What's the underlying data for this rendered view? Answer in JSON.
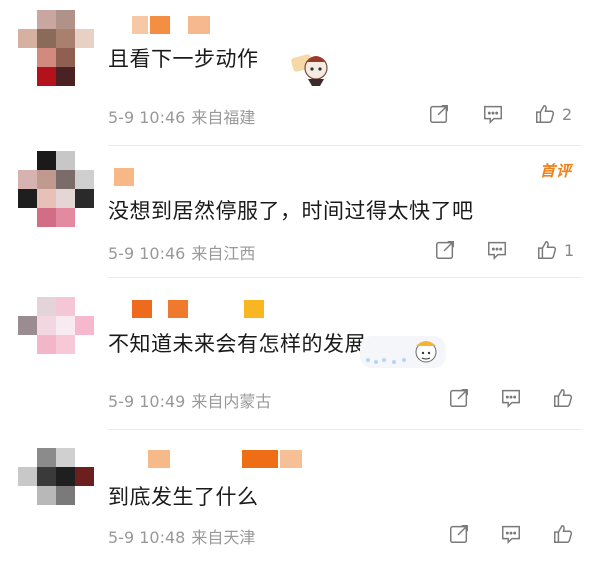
{
  "comments": [
    {
      "text": "且看下一步动作",
      "date": "5-9 10:46",
      "location": "来自福建",
      "likes": "2",
      "badge": ""
    },
    {
      "text": "没想到居然停服了，时间过得太快了吧",
      "date": "5-9 10:46",
      "location": "来自江西",
      "likes": "1",
      "badge": "首评"
    },
    {
      "text": "不知道未来会有怎样的发展",
      "date": "5-9 10:49",
      "location": "来自内蒙古",
      "likes": "",
      "badge": ""
    },
    {
      "text": "到底发生了什么",
      "date": "5-9 10:48",
      "location": "来自天津",
      "likes": "",
      "badge": ""
    }
  ],
  "colors": {
    "accent_orange": "#f0811a",
    "meta_gray": "#999999",
    "divider": "#ececec"
  },
  "icons": [
    "share-icon",
    "comment-icon",
    "like-icon",
    "sticker-icon"
  ]
}
